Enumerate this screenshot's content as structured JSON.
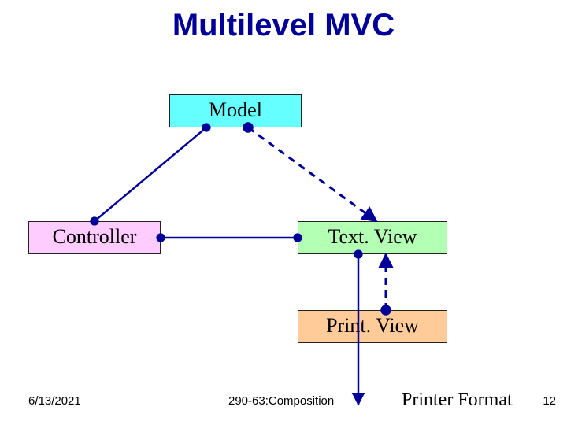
{
  "title": "Multilevel MVC",
  "boxes": {
    "model": "Model",
    "controller": "Controller",
    "textview": "Text. View",
    "printview": "Print. View"
  },
  "footer": {
    "date": "6/13/2021",
    "course": "290-63:Composition",
    "printer_format": "Printer Format",
    "slide_number": "12"
  },
  "colors": {
    "title": "#000099",
    "line_solid": "#000099",
    "line_dashed": "#000099",
    "model_bg": "#66ffff",
    "controller_bg": "#ffccff",
    "textview_bg": "#b3ffb3",
    "printview_bg": "#ffcc99"
  },
  "chart_data": {
    "type": "diagram",
    "title": "Multilevel MVC",
    "nodes": [
      {
        "id": "model",
        "label": "Model"
      },
      {
        "id": "controller",
        "label": "Controller"
      },
      {
        "id": "textview",
        "label": "Text. View"
      },
      {
        "id": "printview",
        "label": "Print. View"
      }
    ],
    "edges": [
      {
        "from": "controller",
        "to": "model",
        "style": "solid"
      },
      {
        "from": "model",
        "to": "textview",
        "style": "dashed"
      },
      {
        "from": "controller",
        "to": "textview",
        "style": "solid"
      },
      {
        "from": "textview",
        "to": "printview",
        "style": "solid"
      },
      {
        "from": "printview",
        "to": "textview",
        "style": "dashed"
      }
    ]
  }
}
